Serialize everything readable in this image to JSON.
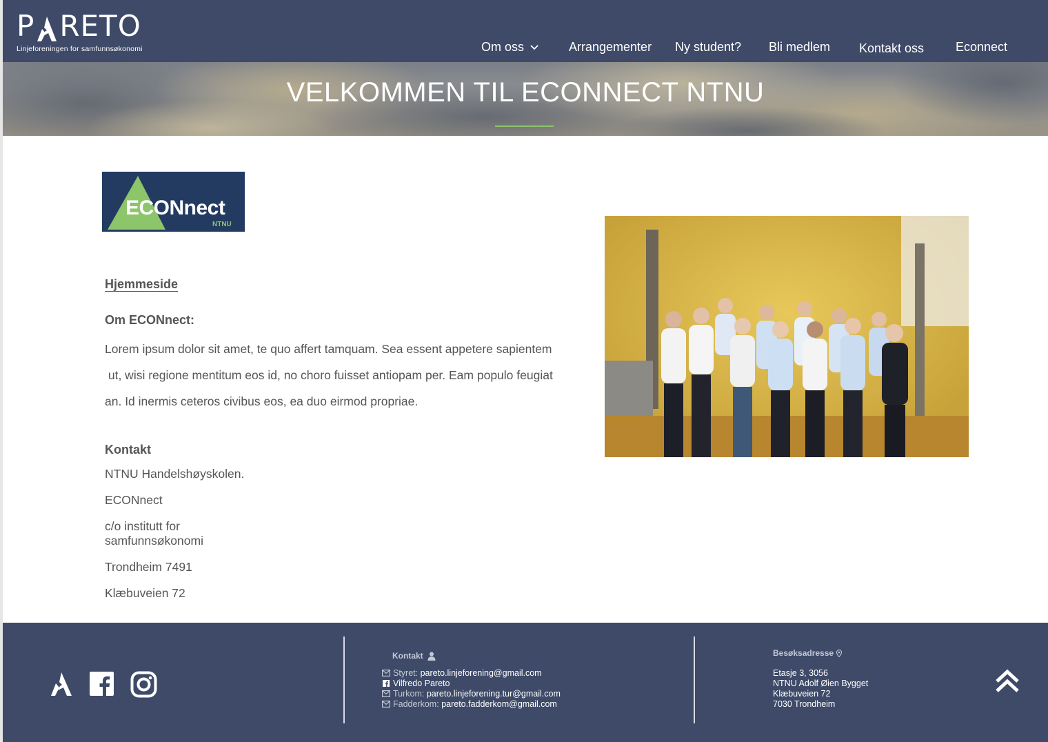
{
  "header": {
    "logo_text_p": "P",
    "logo_text_reto": "RETO",
    "logo_tagline": "Linjeforeningen for samfunnsøkonomi",
    "nav": [
      {
        "label": "Om oss",
        "has_dropdown": true
      },
      {
        "label": "Arrangementer"
      },
      {
        "label": "Ny student?"
      },
      {
        "label": "Bli medlem"
      },
      {
        "label": "Kontakt oss"
      },
      {
        "label": "Econnect"
      }
    ]
  },
  "hero": {
    "title": "VELKOMMEN TIL ECONNECT NTNU"
  },
  "main": {
    "econnect_logo": {
      "text": "ECONnect",
      "sub": "NTNU"
    },
    "homepage_link": "Hjemmeside",
    "about_heading": "Om ECONnect:",
    "about_lines": [
      "Lorem ipsum dolor sit amet, te quo affert tamquam. Sea essent appetere sapientem",
      " ut, wisi regione mentitum eos id, no choro fuisset antiopam per. Eam populo feugiat",
      "an. Id inermis ceteros civibus eos, ea duo eirmod propriae."
    ],
    "contact_heading": "Kontakt",
    "contact_lines": [
      "NTNU Handelshøyskolen.",
      "ECONnect",
      "c/o institutt for",
      "samfunnsøkonomi",
      "Trondheim 7491",
      "Klæbuveien 72"
    ]
  },
  "footer": {
    "social_icons": [
      "pareto-logo-icon",
      "facebook-icon",
      "instagram-icon"
    ],
    "contact_heading": "Kontakt",
    "contact": [
      {
        "icon": "mail-icon",
        "label": "Styret:",
        "value": "pareto.linjeforening@gmail.com"
      },
      {
        "icon": "facebook-small-icon",
        "label": "",
        "value": "Vilfredo Pareto"
      },
      {
        "icon": "mail-icon",
        "label": "Turkom:",
        "value": "pareto.linjeforening.tur@gmail.com"
      },
      {
        "icon": "mail-icon",
        "label": "Fadderkom:",
        "value": "pareto.fadderkom@gmail.com"
      }
    ],
    "address_heading": "Besøksadresse",
    "address": [
      "Etasje 3, 3056",
      "NTNU Adolf Øien Bygget",
      "Klæbuveien 72",
      "7030 Trondheim"
    ]
  },
  "colors": {
    "navy": "#3e4a68",
    "accent_green": "#8cc56a",
    "econnect_blue": "#233a61"
  }
}
